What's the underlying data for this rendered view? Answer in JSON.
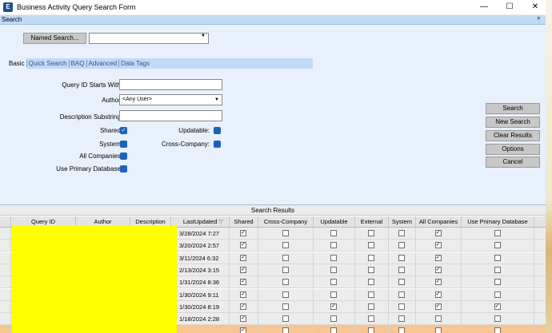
{
  "window": {
    "title": "Business Activity Query Search Form",
    "icon": "app-icon",
    "controls": {
      "minimize": "—",
      "maximize": "☐",
      "close": "✕"
    }
  },
  "search_bar": {
    "label": "Search",
    "pin": "ᵖ"
  },
  "named_search": {
    "button": "Named Search...",
    "value": ""
  },
  "tabs": [
    {
      "label": "Basic",
      "active": true
    },
    {
      "label": "Quick Search"
    },
    {
      "label": "BAQ"
    },
    {
      "label": "Advanced"
    },
    {
      "label": "Data Tags"
    }
  ],
  "form": {
    "query_id_label": "Query ID Starts With:",
    "query_id_value": "",
    "author_label": "Author:",
    "author_value": "<Any User>",
    "description_label": "Description Substring:",
    "description_value": "",
    "shared_label": "Shared:",
    "updatable_label": "Updatable:",
    "system_label": "System:",
    "cross_company_label": "Cross-Company:",
    "all_companies_label": "All Companies:",
    "use_primary_db_label": "Use Primary Database:",
    "checked": "✓"
  },
  "actions": {
    "search": "Search",
    "new_search": "New Search",
    "clear_results": "Clear Results",
    "options": "Options",
    "cancel": "Cancel"
  },
  "results": {
    "title": "Search Results",
    "columns": [
      "Query ID",
      "Author",
      "Description",
      "LastUpdated",
      "Shared",
      "Cross-Company",
      "Updatable",
      "External",
      "System",
      "All Companies",
      "Use Primary Database"
    ],
    "sort_indicator": "▽",
    "rows": [
      {
        "last_updated": "3/28/2024 7:27",
        "shared": true,
        "cross": false,
        "upd": false,
        "ext": false,
        "sys": false,
        "all": true,
        "prim": false
      },
      {
        "last_updated": "3/20/2024 2:57",
        "shared": true,
        "cross": false,
        "upd": false,
        "ext": false,
        "sys": false,
        "all": true,
        "prim": false
      },
      {
        "last_updated": "3/11/2024 6:32",
        "shared": true,
        "cross": false,
        "upd": false,
        "ext": false,
        "sys": false,
        "all": true,
        "prim": false
      },
      {
        "last_updated": "2/13/2024 3:15",
        "shared": true,
        "cross": false,
        "upd": false,
        "ext": false,
        "sys": false,
        "all": true,
        "prim": false
      },
      {
        "last_updated": "1/31/2024 8:36",
        "shared": true,
        "cross": false,
        "upd": false,
        "ext": false,
        "sys": false,
        "all": true,
        "prim": false
      },
      {
        "last_updated": "1/30/2024 9:11",
        "shared": true,
        "cross": false,
        "upd": false,
        "ext": false,
        "sys": false,
        "all": true,
        "prim": false
      },
      {
        "last_updated": "1/30/2024 8:19",
        "shared": true,
        "cross": false,
        "upd": true,
        "ext": false,
        "sys": false,
        "all": true,
        "prim": true
      },
      {
        "last_updated": "1/18/2024 2:28",
        "shared": true,
        "cross": false,
        "upd": false,
        "ext": false,
        "sys": false,
        "all": false,
        "prim": false
      },
      {
        "last_updated": "",
        "shared": true,
        "cross": false,
        "upd": false,
        "ext": false,
        "sys": false,
        "all": false,
        "prim": false,
        "selected": true
      }
    ]
  },
  "colors": {
    "accent": "#1d62b8",
    "selected_row": "#f7c68e",
    "redaction": "#ffff00"
  }
}
